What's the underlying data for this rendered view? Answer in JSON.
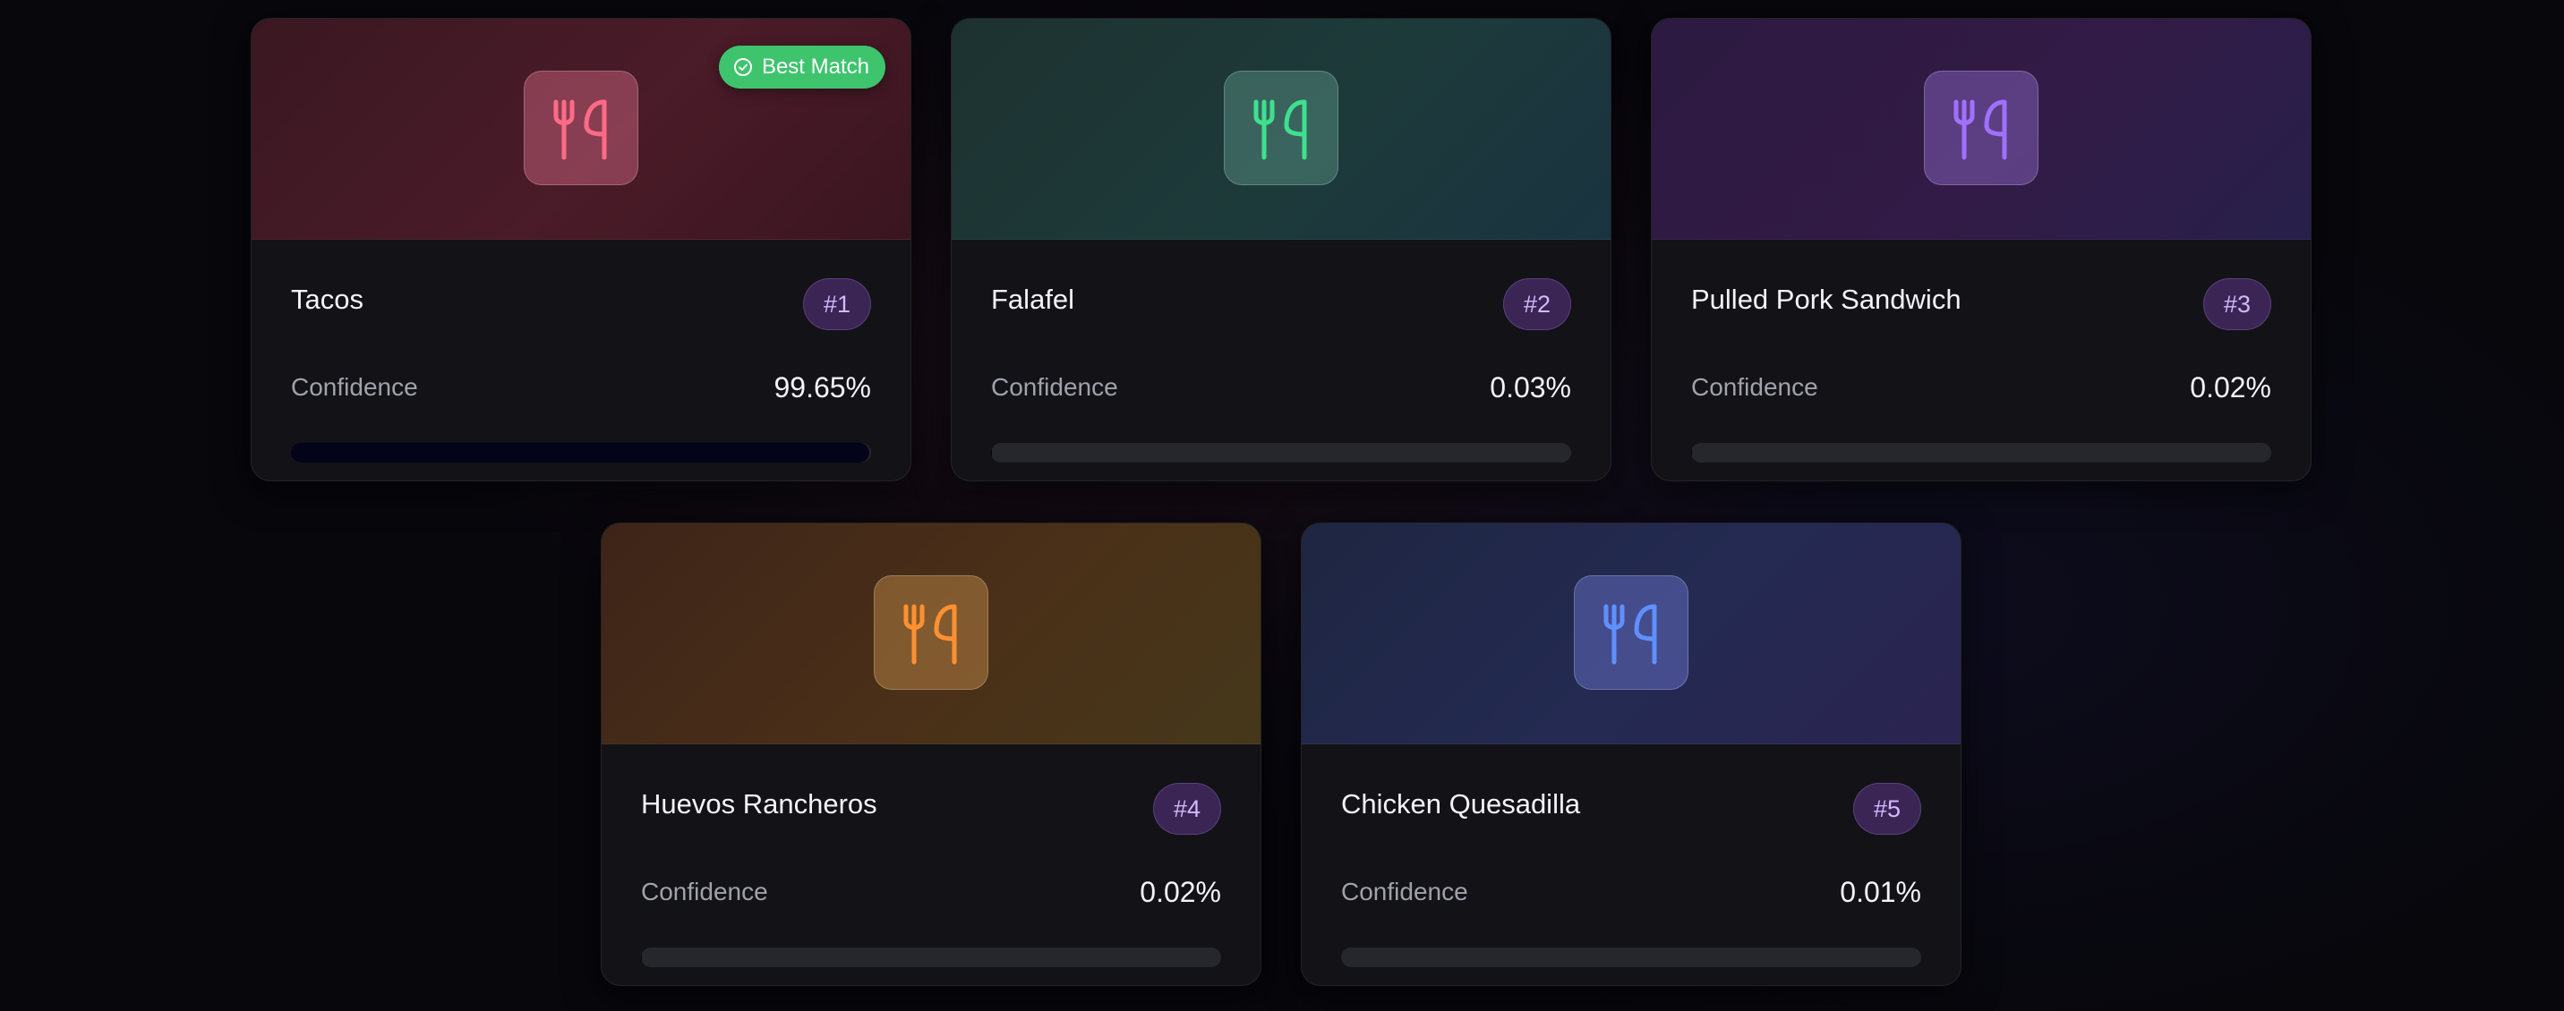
{
  "badge_best_match": "Best Match",
  "confidence_label": "Confidence",
  "cards": [
    {
      "name": "Tacos",
      "rank": "#1",
      "confidence": "99.65%",
      "confidence_fraction": 0.9965,
      "accent": "#ff6b86",
      "icon": "utensils-icon"
    },
    {
      "name": "Falafel",
      "rank": "#2",
      "confidence": "0.03%",
      "confidence_fraction": 0.0003,
      "accent": "#3ee08f",
      "icon": "utensils-icon"
    },
    {
      "name": "Pulled Pork Sandwich",
      "rank": "#3",
      "confidence": "0.02%",
      "confidence_fraction": 0.0002,
      "accent": "#a070ff",
      "icon": "utensils-icon"
    },
    {
      "name": "Huevos Rancheros",
      "rank": "#4",
      "confidence": "0.02%",
      "confidence_fraction": 0.0002,
      "accent": "#ff9030",
      "icon": "utensils-icon"
    },
    {
      "name": "Chicken Quesadilla",
      "rank": "#5",
      "confidence": "0.01%",
      "confidence_fraction": 0.0001,
      "accent": "#5f90ff",
      "icon": "utensils-icon"
    }
  ]
}
